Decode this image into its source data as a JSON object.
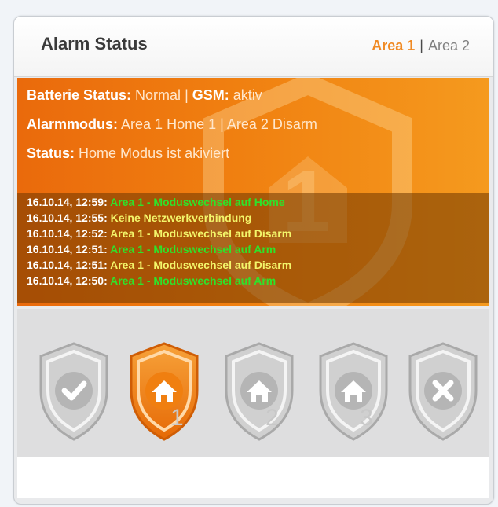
{
  "header": {
    "title": "Alarm Status",
    "tabs": [
      {
        "label": "Area 1",
        "active": true
      },
      {
        "label": "Area 2",
        "active": false
      }
    ],
    "separator": "|"
  },
  "status": {
    "battery_label": "Batterie Status:",
    "battery_value": "Normal",
    "divider": "|",
    "gsm_label": "GSM:",
    "gsm_value": "aktiv",
    "mode_label": "Alarmmodus:",
    "mode_area1": "Area 1 Home 1",
    "mode_area2": "Area 2 Disarm",
    "status_label": "Status:",
    "status_value": "Home Modus ist akiviert"
  },
  "log": [
    {
      "timestamp": "16.10.14, 12:59:",
      "message": "Area 1 - Moduswechsel auf Home",
      "color": "green"
    },
    {
      "timestamp": "16.10.14, 12:55:",
      "message": "Keine Netzwerkverbindung",
      "color": "yellow"
    },
    {
      "timestamp": "16.10.14, 12:52:",
      "message": "Area 1 - Moduswechsel auf Disarm",
      "color": "yellow"
    },
    {
      "timestamp": "16.10.14, 12:51:",
      "message": "Area 1 - Moduswechsel auf Arm",
      "color": "green"
    },
    {
      "timestamp": "16.10.14, 12:51:",
      "message": "Area 1 - Moduswechsel auf Disarm",
      "color": "yellow"
    },
    {
      "timestamp": "16.10.14, 12:50:",
      "message": "Area 1 - Moduswechsel auf Arm",
      "color": "green"
    }
  ],
  "modes": [
    {
      "icon": "check-shield-icon",
      "number": "",
      "active": false
    },
    {
      "icon": "home-shield-icon",
      "number": "1",
      "active": true
    },
    {
      "icon": "home-shield-icon",
      "number": "2",
      "active": false
    },
    {
      "icon": "home-shield-icon",
      "number": "3",
      "active": false
    },
    {
      "icon": "x-shield-icon",
      "number": "",
      "active": false
    }
  ],
  "colors": {
    "accent": "#f08a24",
    "panel_orange": "#f07f10",
    "log_green": "#2fe22a",
    "log_yellow": "#f3f56a",
    "shield_gray": "#bdbdbd"
  }
}
